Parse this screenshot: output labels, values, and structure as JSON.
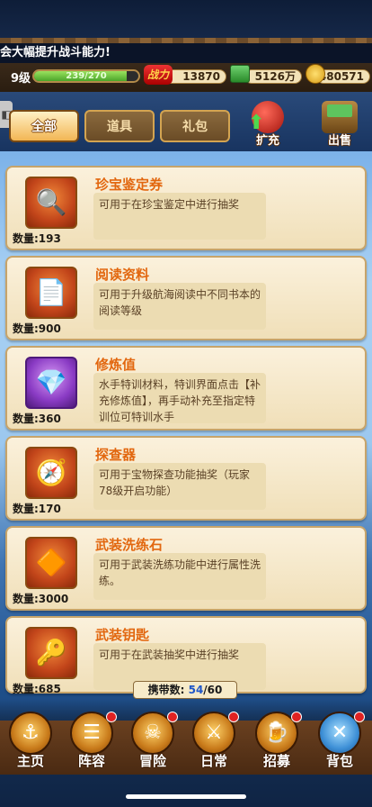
{
  "ticker": "会大幅提升战斗能力!",
  "stats": {
    "level": "9级",
    "exp": "239/270",
    "exp_fraction": 0.885,
    "power_icon_text": "战力",
    "power": "13870",
    "cash": "5126万",
    "gold": "480571"
  },
  "tabs": [
    {
      "label": "全部",
      "active": true
    },
    {
      "label": "道具",
      "active": false
    },
    {
      "label": "礼包",
      "active": false
    }
  ],
  "expand_label": "扩充",
  "sell_label": "出售",
  "items": [
    {
      "name": "珍宝鉴定券",
      "desc": "可用于在珍宝鉴定中进行抽奖",
      "qty": "数量:193",
      "icon": "magnifier-icon"
    },
    {
      "name": "阅读资料",
      "desc": "可用于升级航海阅读中不同书本的阅读等级",
      "qty": "数量:900",
      "icon": "document-icon"
    },
    {
      "name": "修炼值",
      "desc": "水手特训材料，特训界面点击【补充修炼值】，再手动补充至指定特训位可特训水手",
      "qty": "数量:360",
      "icon": "crystal-icon"
    },
    {
      "name": "探查器",
      "desc": "可用于宝物探查功能抽奖（玩家78级开启功能）",
      "qty": "数量:170",
      "icon": "detector-icon"
    },
    {
      "name": "武装洗练石",
      "desc": "可用于武装洗练功能中进行属性洗练。",
      "qty": "数量:3000",
      "icon": "stone-icon"
    },
    {
      "name": "武装钥匙",
      "desc": "可用于在武装抽奖中进行抽奖",
      "qty": "数量:685",
      "icon": "key-icon"
    }
  ],
  "carry": {
    "label": "携带数:",
    "current": "54",
    "max": "/60"
  },
  "nav": [
    {
      "label": "主页",
      "icon": "home-icon",
      "dot": false,
      "active": false
    },
    {
      "label": "阵容",
      "icon": "lineup-icon",
      "dot": true,
      "active": false
    },
    {
      "label": "冒险",
      "icon": "skull-icon",
      "dot": true,
      "active": false
    },
    {
      "label": "日常",
      "icon": "swords-icon",
      "dot": true,
      "active": false
    },
    {
      "label": "招募",
      "icon": "tavern-icon",
      "dot": true,
      "active": false
    },
    {
      "label": "背包",
      "icon": "bag-icon",
      "dot": true,
      "active": true
    }
  ]
}
